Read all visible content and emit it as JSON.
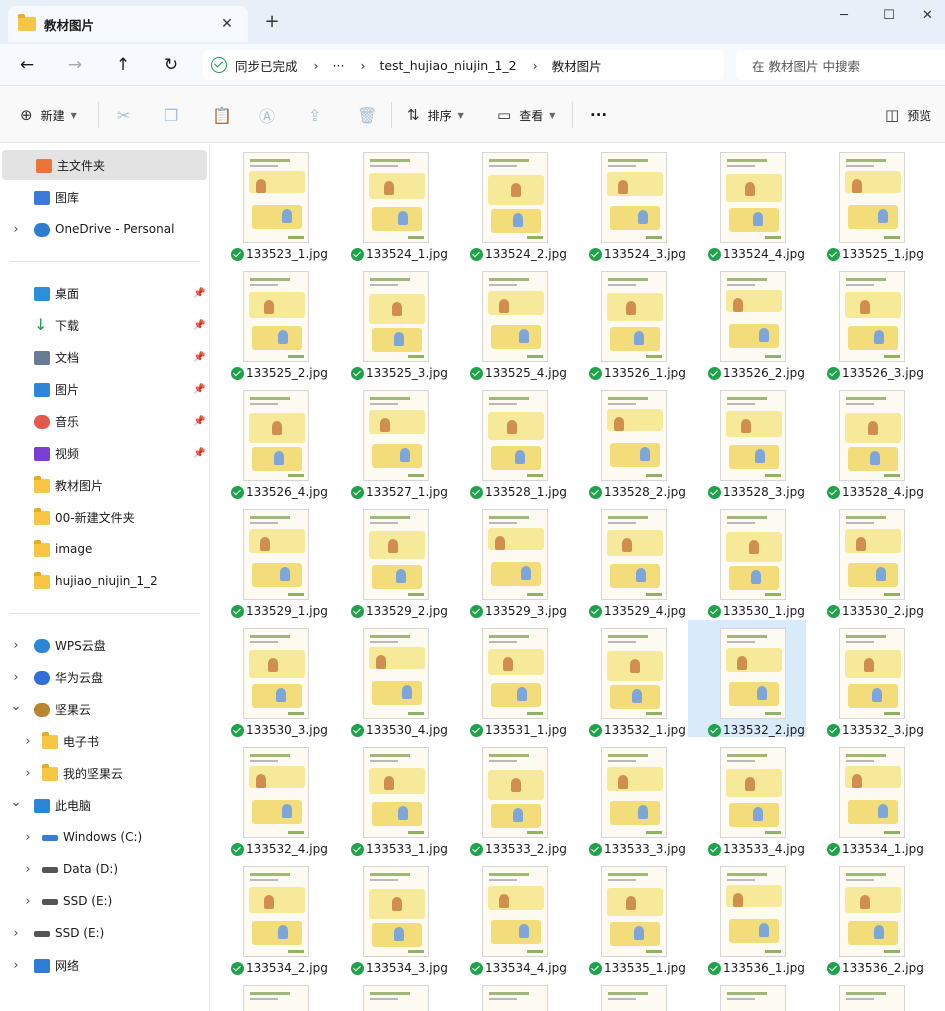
{
  "window": {
    "tab_title": "教材图片",
    "new_tab": "+",
    "tab_close": "✕",
    "minimize": "─",
    "maximize": "☐",
    "close": "✕"
  },
  "address": {
    "sync_status": "同步已完成",
    "ellipsis": "···",
    "crumbs": [
      "test_hujiao_niujin_1_2",
      "教材图片"
    ],
    "search_placeholder": "在 教材图片 中搜索"
  },
  "toolbar": {
    "new_label": "新建",
    "sort_label": "排序",
    "view_label": "查看",
    "more": "···",
    "preview_label": "预览"
  },
  "sidebar": {
    "items": [
      {
        "label": "主文件夹",
        "icon": "home-icon"
      },
      {
        "label": "图库",
        "icon": "gallery-icon"
      },
      {
        "label": "OneDrive - Personal",
        "icon": "cloud-icon"
      },
      {
        "label": "桌面",
        "icon": "desktop-icon"
      },
      {
        "label": "下载",
        "icon": "download-icon"
      },
      {
        "label": "文档",
        "icon": "document-icon"
      },
      {
        "label": "图片",
        "icon": "pictures-icon"
      },
      {
        "label": "音乐",
        "icon": "music-icon"
      },
      {
        "label": "视频",
        "icon": "video-icon"
      },
      {
        "label": "教材图片",
        "icon": "folder-icon"
      },
      {
        "label": "00-新建文件夹",
        "icon": "folder-icon"
      },
      {
        "label": "image",
        "icon": "folder-icon"
      },
      {
        "label": "hujiao_niujin_1_2",
        "icon": "folder-icon"
      },
      {
        "label": "WPS云盘",
        "icon": "cloud-icon"
      },
      {
        "label": "华为云盘",
        "icon": "cloud-icon"
      },
      {
        "label": "坚果云",
        "icon": "nut-icon"
      },
      {
        "label": "电子书",
        "icon": "folder-icon"
      },
      {
        "label": "我的坚果云",
        "icon": "folder-icon"
      },
      {
        "label": "此电脑",
        "icon": "computer-icon"
      },
      {
        "label": "Windows (C:)",
        "icon": "drive-icon"
      },
      {
        "label": "Data (D:)",
        "icon": "drive-icon"
      },
      {
        "label": "SSD (E:)",
        "icon": "drive-icon"
      },
      {
        "label": "SSD (E:)",
        "icon": "drive-icon"
      },
      {
        "label": "网络",
        "icon": "network-icon"
      }
    ]
  },
  "files": [
    "133523_1.jpg",
    "133524_1.jpg",
    "133524_2.jpg",
    "133524_3.jpg",
    "133524_4.jpg",
    "133525_1.jpg",
    "133525_2.jpg",
    "133525_3.jpg",
    "133525_4.jpg",
    "133526_1.jpg",
    "133526_2.jpg",
    "133526_3.jpg",
    "133526_4.jpg",
    "133527_1.jpg",
    "133528_1.jpg",
    "133528_2.jpg",
    "133528_3.jpg",
    "133528_4.jpg",
    "133529_1.jpg",
    "133529_2.jpg",
    "133529_3.jpg",
    "133529_4.jpg",
    "133530_1.jpg",
    "133530_2.jpg",
    "133530_3.jpg",
    "133530_4.jpg",
    "133531_1.jpg",
    "133532_1.jpg",
    "133532_2.jpg",
    "133532_3.jpg",
    "133532_4.jpg",
    "133533_1.jpg",
    "133533_2.jpg",
    "133533_3.jpg",
    "133533_4.jpg",
    "133534_1.jpg",
    "133534_2.jpg",
    "133534_3.jpg",
    "133534_4.jpg",
    "133535_1.jpg",
    "133536_1.jpg",
    "133536_2.jpg"
  ],
  "selected_file": "133532_2.jpg"
}
